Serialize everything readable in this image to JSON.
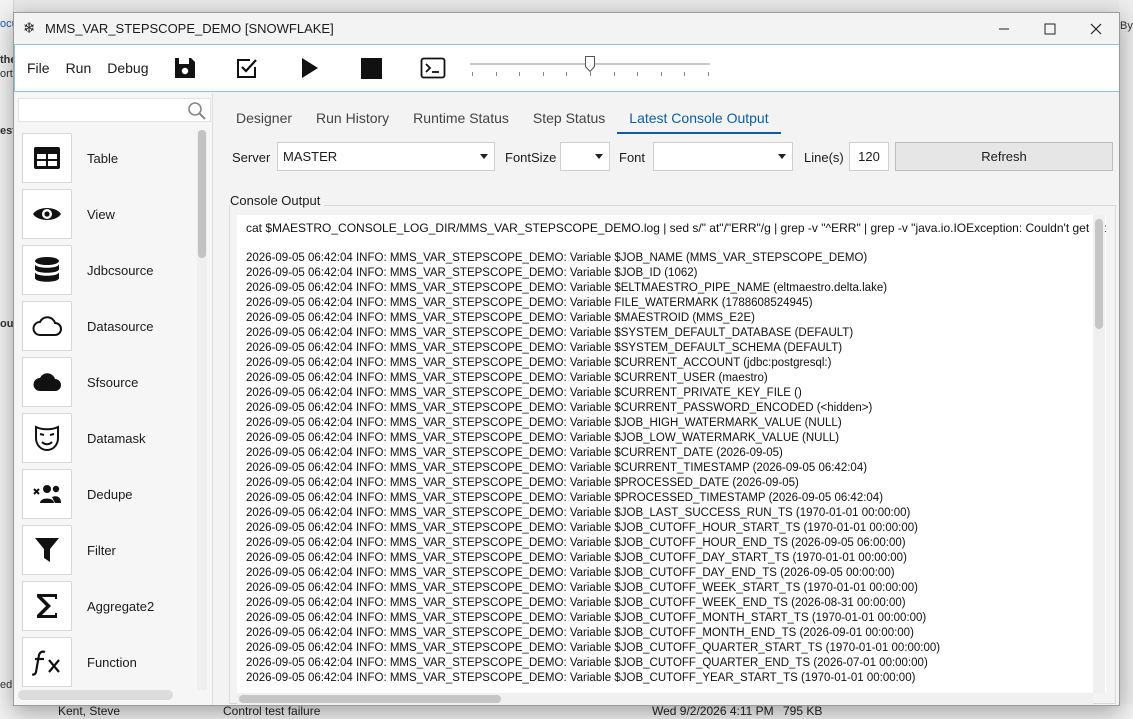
{
  "window": {
    "title": "MMS_VAR_STEPSCOPE_DEMO [SNOWFLAKE]",
    "controls": {
      "minimize": "—",
      "maximize": "☐",
      "close": "✕"
    }
  },
  "menu": [
    "File",
    "Run",
    "Debug"
  ],
  "toolbar": {
    "buttons": [
      "save-icon",
      "checkbox-icon",
      "play-icon",
      "stop-icon",
      "terminal-icon"
    ],
    "slider_value_fraction": 0.5
  },
  "palette": {
    "search_placeholder": "",
    "items": [
      {
        "label": "Table",
        "icon": "table-icon"
      },
      {
        "label": "View",
        "icon": "eye-icon"
      },
      {
        "label": "Jdbcsource",
        "icon": "database-icon"
      },
      {
        "label": "Datasource",
        "icon": "cloud-outline-icon"
      },
      {
        "label": "Sfsource",
        "icon": "cloud-filled-icon"
      },
      {
        "label": "Datamask",
        "icon": "mask-icon"
      },
      {
        "label": "Dedupe",
        "icon": "dedupe-users-icon"
      },
      {
        "label": "Filter",
        "icon": "filter-icon"
      },
      {
        "label": "Aggregate2",
        "icon": "sigma-icon"
      },
      {
        "label": "Function",
        "icon": "function-icon"
      }
    ]
  },
  "tabs": {
    "items": [
      "Designer",
      "Run History",
      "Runtime Status",
      "Step Status",
      "Latest Console Output"
    ],
    "active": "Latest Console Output"
  },
  "controls": {
    "server_label": "Server",
    "server_value": "MASTER",
    "fontsize_label": "FontSize",
    "fontsize_value": "",
    "font_label": "Font",
    "font_value": "",
    "lines_label": "Line(s)",
    "lines_value": "120",
    "refresh_label": "Refresh"
  },
  "console": {
    "label": "Console Output",
    "command": "cat $MAESTRO_CONSOLE_LOG_DIR/MMS_VAR_STEPSCOPE_DEMO.log | sed s/\"      at\"/\"ERR\"/g | grep -v \"^ERR\" | grep -v \"java.io.IOException: Couldn't get lock",
    "lines": [
      "2026-09-05 06:42:04 INFO:  MMS_VAR_STEPSCOPE_DEMO: Variable $JOB_NAME (MMS_VAR_STEPSCOPE_DEMO)",
      "2026-09-05 06:42:04 INFO:  MMS_VAR_STEPSCOPE_DEMO: Variable $JOB_ID (1062)",
      "2026-09-05 06:42:04 INFO:  MMS_VAR_STEPSCOPE_DEMO: Variable $ELTMAESTRO_PIPE_NAME (eltmaestro.delta.lake)",
      "2026-09-05 06:42:04 INFO:  MMS_VAR_STEPSCOPE_DEMO: Variable FILE_WATERMARK (1788608524945)",
      "2026-09-05 06:42:04 INFO:  MMS_VAR_STEPSCOPE_DEMO: Variable $MAESTROID (MMS_E2E)",
      "2026-09-05 06:42:04 INFO:  MMS_VAR_STEPSCOPE_DEMO: Variable $SYSTEM_DEFAULT_DATABASE (DEFAULT)",
      "2026-09-05 06:42:04 INFO:  MMS_VAR_STEPSCOPE_DEMO: Variable $SYSTEM_DEFAULT_SCHEMA (DEFAULT)",
      "2026-09-05 06:42:04 INFO:  MMS_VAR_STEPSCOPE_DEMO: Variable $CURRENT_ACCOUNT (jdbc:postgresql:)",
      "2026-09-05 06:42:04 INFO:  MMS_VAR_STEPSCOPE_DEMO: Variable $CURRENT_USER (maestro)",
      "2026-09-05 06:42:04 INFO:  MMS_VAR_STEPSCOPE_DEMO: Variable $CURRENT_PRIVATE_KEY_FILE ()",
      "2026-09-05 06:42:04 INFO:  MMS_VAR_STEPSCOPE_DEMO: Variable $CURRENT_PASSWORD_ENCODED (<hidden>)",
      "2026-09-05 06:42:04 INFO:  MMS_VAR_STEPSCOPE_DEMO: Variable $JOB_HIGH_WATERMARK_VALUE (NULL)",
      "2026-09-05 06:42:04 INFO:  MMS_VAR_STEPSCOPE_DEMO: Variable $JOB_LOW_WATERMARK_VALUE (NULL)",
      "2026-09-05 06:42:04 INFO:  MMS_VAR_STEPSCOPE_DEMO: Variable $CURRENT_DATE (2026-09-05)",
      "2026-09-05 06:42:04 INFO:  MMS_VAR_STEPSCOPE_DEMO: Variable $CURRENT_TIMESTAMP (2026-09-05 06:42:04)",
      "2026-09-05 06:42:04 INFO:  MMS_VAR_STEPSCOPE_DEMO: Variable $PROCESSED_DATE (2026-09-05)",
      "2026-09-05 06:42:04 INFO:  MMS_VAR_STEPSCOPE_DEMO: Variable $PROCESSED_TIMESTAMP (2026-09-05 06:42:04)",
      "2026-09-05 06:42:04 INFO:  MMS_VAR_STEPSCOPE_DEMO: Variable $JOB_LAST_SUCCESS_RUN_TS (1970-01-01 00:00:00)",
      "2026-09-05 06:42:04 INFO:  MMS_VAR_STEPSCOPE_DEMO: Variable $JOB_CUTOFF_HOUR_START_TS (1970-01-01 00:00:00)",
      "2026-09-05 06:42:04 INFO:  MMS_VAR_STEPSCOPE_DEMO: Variable $JOB_CUTOFF_HOUR_END_TS (2026-09-05 06:00:00)",
      "2026-09-05 06:42:04 INFO:  MMS_VAR_STEPSCOPE_DEMO: Variable $JOB_CUTOFF_DAY_START_TS (1970-01-01 00:00:00)",
      "2026-09-05 06:42:04 INFO:  MMS_VAR_STEPSCOPE_DEMO: Variable $JOB_CUTOFF_DAY_END_TS (2026-09-05 00:00:00)",
      "2026-09-05 06:42:04 INFO:  MMS_VAR_STEPSCOPE_DEMO: Variable $JOB_CUTOFF_WEEK_START_TS (1970-01-01 00:00:00)",
      "2026-09-05 06:42:04 INFO:  MMS_VAR_STEPSCOPE_DEMO: Variable $JOB_CUTOFF_WEEK_END_TS (2026-08-31 00:00:00)",
      "2026-09-05 06:42:04 INFO:  MMS_VAR_STEPSCOPE_DEMO: Variable $JOB_CUTOFF_MONTH_START_TS (1970-01-01 00:00:00)",
      "2026-09-05 06:42:04 INFO:  MMS_VAR_STEPSCOPE_DEMO: Variable $JOB_CUTOFF_MONTH_END_TS (2026-09-01 00:00:00)",
      "2026-09-05 06:42:04 INFO:  MMS_VAR_STEPSCOPE_DEMO: Variable $JOB_CUTOFF_QUARTER_START_TS (1970-01-01 00:00:00)",
      "2026-09-05 06:42:04 INFO:  MMS_VAR_STEPSCOPE_DEMO: Variable $JOB_CUTOFF_QUARTER_END_TS (2026-07-01 00:00:00)",
      "2026-09-05 06:42:04 INFO:  MMS_VAR_STEPSCOPE_DEMO: Variable $JOB_CUTOFF_YEAR_START_TS (1970-01-01 00:00:00)"
    ]
  },
  "background": {
    "left_fragments": [
      "ocu",
      "the",
      "ortF",
      "este",
      "our",
      "ed"
    ],
    "right_fragments": [
      "By"
    ],
    "bottom_row": {
      "sender": "Kent, Steve",
      "subject": "Control test failure",
      "date": "Wed 9/2/2026 4:11 PM",
      "size": "795 KB"
    }
  }
}
